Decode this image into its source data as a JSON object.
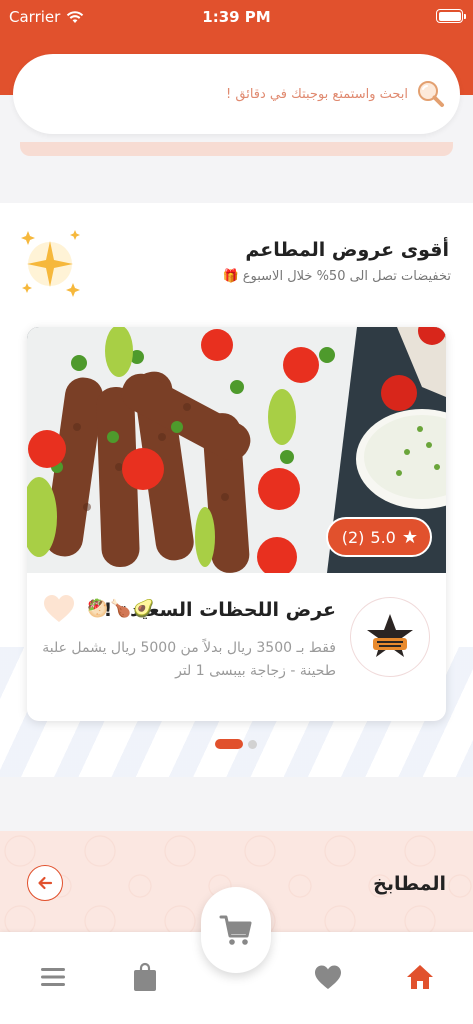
{
  "status_bar": {
    "carrier": "Carrier",
    "time": "1:39 PM"
  },
  "search": {
    "placeholder": "ابحث واستمتع بوجبتك في دقائق !"
  },
  "offers": {
    "title": "أقوى عروض المطاعم",
    "subtitle": "تخفيضات تصل الى 50% خلال الاسبوع",
    "card": {
      "rating": "5.0",
      "rating_count": "(2)",
      "title": "عرض اللحظات السعيدة !",
      "description": "فقط بـ 3500 ريال بدلاً من 5000 ريال يشمل علبة طحينة - زجاجة بيبسى 1 لتر",
      "emojis": [
        "🥙",
        "🍗",
        "🥑"
      ]
    },
    "pagination": {
      "active_index": 0,
      "count": 2
    }
  },
  "kitchens": {
    "title": "المطابخ"
  },
  "tabbar": {
    "items": [
      "home-icon",
      "heart-icon",
      "cart-icon",
      "bag-icon",
      "menu-icon"
    ],
    "active": "home-icon"
  },
  "colors": {
    "accent": "#e1512d",
    "background": "#f4f4f6"
  }
}
